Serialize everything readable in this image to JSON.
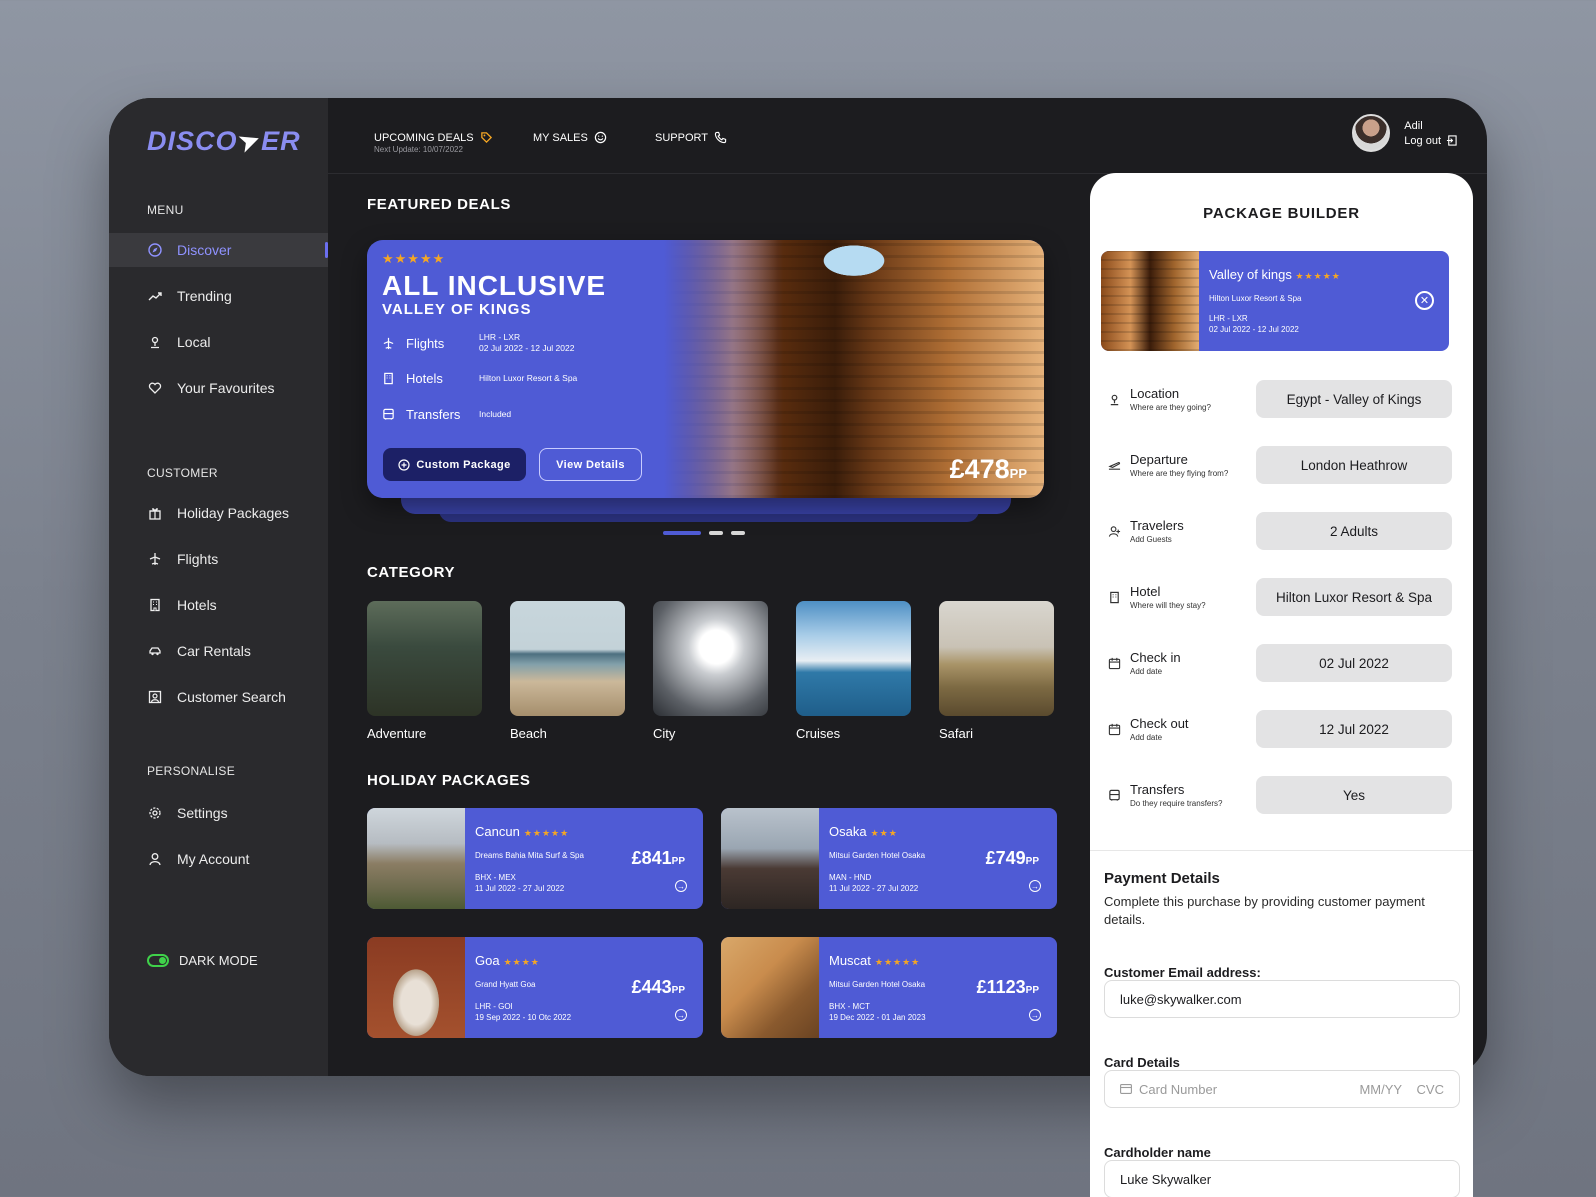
{
  "brand": {
    "logo_left": "DISCO",
    "logo_right": "ER"
  },
  "sidebar": {
    "menu_title": "MENU",
    "menu_items": [
      {
        "label": "Discover",
        "icon": "compass-icon"
      },
      {
        "label": "Trending",
        "icon": "trending-icon"
      },
      {
        "label": "Local",
        "icon": "location-icon"
      },
      {
        "label": "Your Favourites",
        "icon": "heart-icon"
      }
    ],
    "customer_title": "CUSTOMER",
    "customer_items": [
      {
        "label": "Holiday Packages",
        "icon": "gift-icon"
      },
      {
        "label": "Flights",
        "icon": "plane-icon"
      },
      {
        "label": "Hotels",
        "icon": "building-icon"
      },
      {
        "label": "Car Rentals",
        "icon": "car-icon"
      },
      {
        "label": "Customer Search",
        "icon": "user-search-icon"
      }
    ],
    "personalise_title": "PERSONALISE",
    "personalise_items": [
      {
        "label": "Settings",
        "icon": "gear-icon"
      },
      {
        "label": "My Account",
        "icon": "user-icon"
      }
    ],
    "dark_mode_label": "DARK MODE"
  },
  "topbar": {
    "upcoming_deals": "UPCOMING DEALS",
    "next_update": "Next Update: 10/07/2022",
    "my_sales": "MY SALES",
    "support": "SUPPORT",
    "user_name": "Adil",
    "logout": "Log out"
  },
  "featured": {
    "section_title": "FEATURED DEALS",
    "stars": "★★★★★",
    "title": "ALL INCLUSIVE",
    "subtitle": "VALLEY OF KINGS",
    "flights_label": "Flights",
    "flights_route": "LHR - LXR",
    "flights_dates": "02 Jul 2022 - 12 Jul 2022",
    "hotels_label": "Hotels",
    "hotels_value": "Hilton Luxor Resort & Spa",
    "transfers_label": "Transfers",
    "transfers_value": "Included",
    "custom_button": "Custom Package",
    "view_button": "View Details",
    "price": "£478",
    "price_unit": "PP"
  },
  "category": {
    "section_title": "CATEGORY",
    "items": [
      "Adventure",
      "Beach",
      "City",
      "Cruises",
      "Safari"
    ]
  },
  "holiday_packages": {
    "section_title": "HOLIDAY PACKAGES",
    "items": [
      {
        "name": "Cancun",
        "stars": "★★★★★",
        "hotel": "Dreams Bahia Mita Surf & Spa",
        "route": "BHX - MEX",
        "dates": "11 Jul 2022 - 27 Jul 2022",
        "price": "£841",
        "unit": "PP"
      },
      {
        "name": "Osaka",
        "stars": "★★★",
        "hotel": "Mitsui Garden Hotel Osaka",
        "route": "MAN - HND",
        "dates": "11 Jul 2022 - 27 Jul 2022",
        "price": "£749",
        "unit": "PP"
      },
      {
        "name": "Goa",
        "stars": "★★★★",
        "hotel": "Grand Hyatt Goa",
        "route": "LHR - GOI",
        "dates": "19 Sep 2022 - 10 Otc 2022",
        "price": "£443",
        "unit": "PP"
      },
      {
        "name": "Muscat",
        "stars": "★★★★★",
        "hotel": "Mitsui Garden Hotel Osaka",
        "route": "BHX - MCT",
        "dates": "19 Dec 2022 - 01 Jan 2023",
        "price": "£1123",
        "unit": "PP"
      }
    ]
  },
  "builder": {
    "title": "PACKAGE BUILDER",
    "card": {
      "name": "Valley of kings",
      "stars": "★★★★★",
      "hotel": "Hilton Luxor Resort & Spa",
      "route": "LHR - LXR",
      "dates": "02 Jul 2022 - 12 Jul 2022"
    },
    "rows": [
      {
        "label": "Location",
        "sub": "Where are they going?",
        "value": "Egypt - Valley of Kings",
        "icon": "location-icon"
      },
      {
        "label": "Departure",
        "sub": "Where are they flying from?",
        "value": "London Heathrow",
        "icon": "plane-departure-icon"
      },
      {
        "label": "Travelers",
        "sub": "Add Guests",
        "value": "2 Adults",
        "icon": "user-add-icon"
      },
      {
        "label": "Hotel",
        "sub": "Where will they stay?",
        "value": "Hilton Luxor Resort & Spa",
        "icon": "building-icon"
      },
      {
        "label": "Check in",
        "sub": "Add date",
        "value": "02 Jul 2022",
        "icon": "calendar-icon"
      },
      {
        "label": "Check out",
        "sub": "Add date",
        "value": "12 Jul 2022",
        "icon": "calendar-icon"
      },
      {
        "label": "Transfers",
        "sub": "Do they require transfers?",
        "value": "Yes",
        "icon": "bus-icon"
      }
    ],
    "payment": {
      "title": "Payment Details",
      "description": "Complete this purchase by providing customer payment details.",
      "email_label": "Customer Email address:",
      "email_value": "luke@skywalker.com",
      "card_label": "Card Details",
      "card_placeholder": "Card Number",
      "card_mmyy": "MM/YY",
      "card_cvc": "CVC",
      "holder_label": "Cardholder name",
      "holder_value": "Luke Skywalker"
    }
  }
}
